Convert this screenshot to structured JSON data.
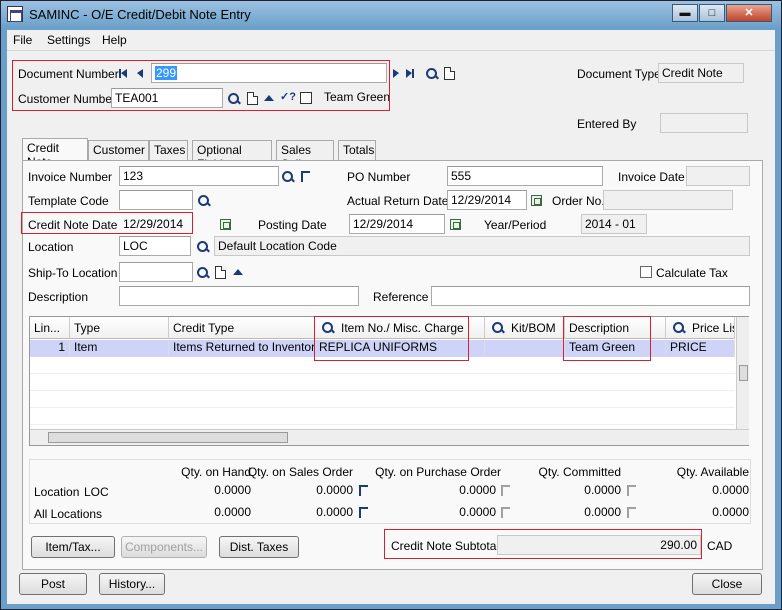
{
  "window": {
    "title": "SAMINC - O/E Credit/Debit Note Entry",
    "minimize": "▬",
    "maximize": "□",
    "close": "✕"
  },
  "menu": [
    "File",
    "Settings",
    "Help"
  ],
  "header": {
    "document_number_label": "Document Number",
    "document_number_value": "299",
    "customer_number_label": "Customer Number",
    "customer_number_value": "TEA001",
    "customer_name": "Team Green",
    "document_type_label": "Document Type",
    "document_type_value": "Credit Note",
    "entered_by_label": "Entered By",
    "entered_by_value": ""
  },
  "tabs": [
    "Credit Note",
    "Customer",
    "Taxes",
    "Optional Fields",
    "Sales Split",
    "Totals"
  ],
  "form": {
    "invoice_number_label": "Invoice Number",
    "invoice_number_value": "123",
    "po_number_label": "PO Number",
    "po_number_value": "555",
    "invoice_date_label": "Invoice Date",
    "invoice_date_value": "",
    "template_code_label": "Template Code",
    "template_code_value": "",
    "actual_return_date_label": "Actual Return Date",
    "actual_return_date_value": "12/29/2014",
    "order_no_label": "Order No.",
    "order_no_value": "",
    "credit_note_date_label": "Credit Note Date",
    "credit_note_date_value": "12/29/2014",
    "posting_date_label": "Posting Date",
    "posting_date_value": "12/29/2014",
    "year_period_label": "Year/Period",
    "year_period_value": "2014 - 01",
    "location_label": "Location",
    "location_value": "LOC",
    "location_desc": "Default Location Code",
    "ship_to_label": "Ship-To Location",
    "ship_to_value": "",
    "calculate_tax_label": "Calculate Tax",
    "description_label": "Description",
    "description_value": "",
    "reference_label": "Reference",
    "reference_value": ""
  },
  "grid": {
    "columns": [
      "Lin...",
      "Type",
      "Credit Type",
      "Item No./ Misc. Charge",
      "Kit/BOM",
      "Description",
      "Price Lis"
    ],
    "rows": [
      {
        "line": "1",
        "type": "Item",
        "credit_type": "Items Returned to Inventory",
        "item": "REPLICA UNIFORMS",
        "kit": "",
        "description": "Team Green",
        "price_list": "PRICE"
      }
    ]
  },
  "qty": {
    "headers": [
      "Qty. on Hand",
      "Qty. on Sales Order",
      "Qty. on Purchase Order",
      "Qty. Committed",
      "Qty. Available"
    ],
    "rows": [
      {
        "label": "Location",
        "loc": "LOC",
        "values": [
          "0.0000",
          "0.0000",
          "0.0000",
          "0.0000",
          "0.0000"
        ]
      },
      {
        "label": "All Locations",
        "loc": "",
        "values": [
          "0.0000",
          "0.0000",
          "0.0000",
          "0.0000",
          "0.0000"
        ]
      }
    ]
  },
  "buttons": {
    "item_tax": "Item/Tax...",
    "components": "Components...",
    "dist_taxes": "Dist. Taxes",
    "post": "Post",
    "history": "History...",
    "close": "Close"
  },
  "subtotal": {
    "label": "Credit Note Subtotal",
    "value": "290.00",
    "currency": "CAD"
  }
}
